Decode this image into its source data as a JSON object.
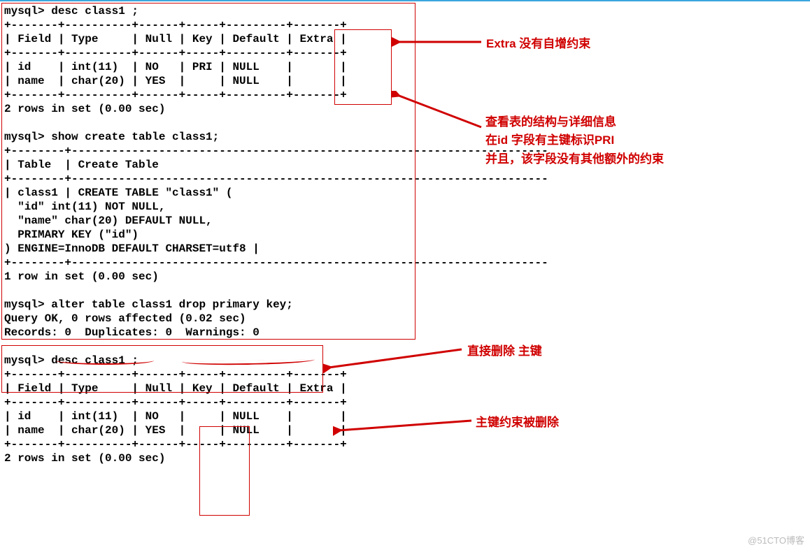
{
  "terminal": {
    "block1": "mysql> desc class1 ;\n+-------+----------+------+-----+---------+-------+\n| Field | Type     | Null | Key | Default | Extra |\n+-------+----------+------+-----+---------+-------+\n| id    | int(11)  | NO   | PRI | NULL    |       |\n| name  | char(20) | YES  |     | NULL    |       |\n+-------+----------+------+-----+---------+-------+\n2 rows in set (0.00 sec)\n\nmysql> show create table class1;\n+--------+-----------------------------------------------------------------------\n| Table  | Create Table\n+--------+-----------------------------------------------------------------------\n| class1 | CREATE TABLE \"class1\" (\n  \"id\" int(11) NOT NULL,\n  \"name\" char(20) DEFAULT NULL,\n  PRIMARY KEY (\"id\")\n) ENGINE=InnoDB DEFAULT CHARSET=utf8 |\n+--------+-----------------------------------------------------------------------\n1 row in set (0.00 sec)\n\nmysql> alter table class1 drop primary key;\nQuery OK, 0 rows affected (0.02 sec)\nRecords: 0  Duplicates: 0  Warnings: 0\n\nmysql> desc class1 ;\n+-------+----------+------+-----+---------+-------+\n| Field | Type     | Null | Key | Default | Extra |\n+-------+----------+------+-----+---------+-------+\n| id    | int(11)  | NO   |     | NULL    |       |\n| name  | char(20) | YES  |     | NULL    |       |\n+-------+----------+------+-----+---------+-------+\n2 rows in set (0.00 sec)"
  },
  "annotations": {
    "a1": "Extra 没有自增约束",
    "a2": "查看表的结构与详细信息\n在id 字段有主键标识PRI\n并且，该字段没有其他额外的约束",
    "a3": "直接删除 主键",
    "a4": "主键约束被删除"
  },
  "watermark": "@51CTO博客"
}
